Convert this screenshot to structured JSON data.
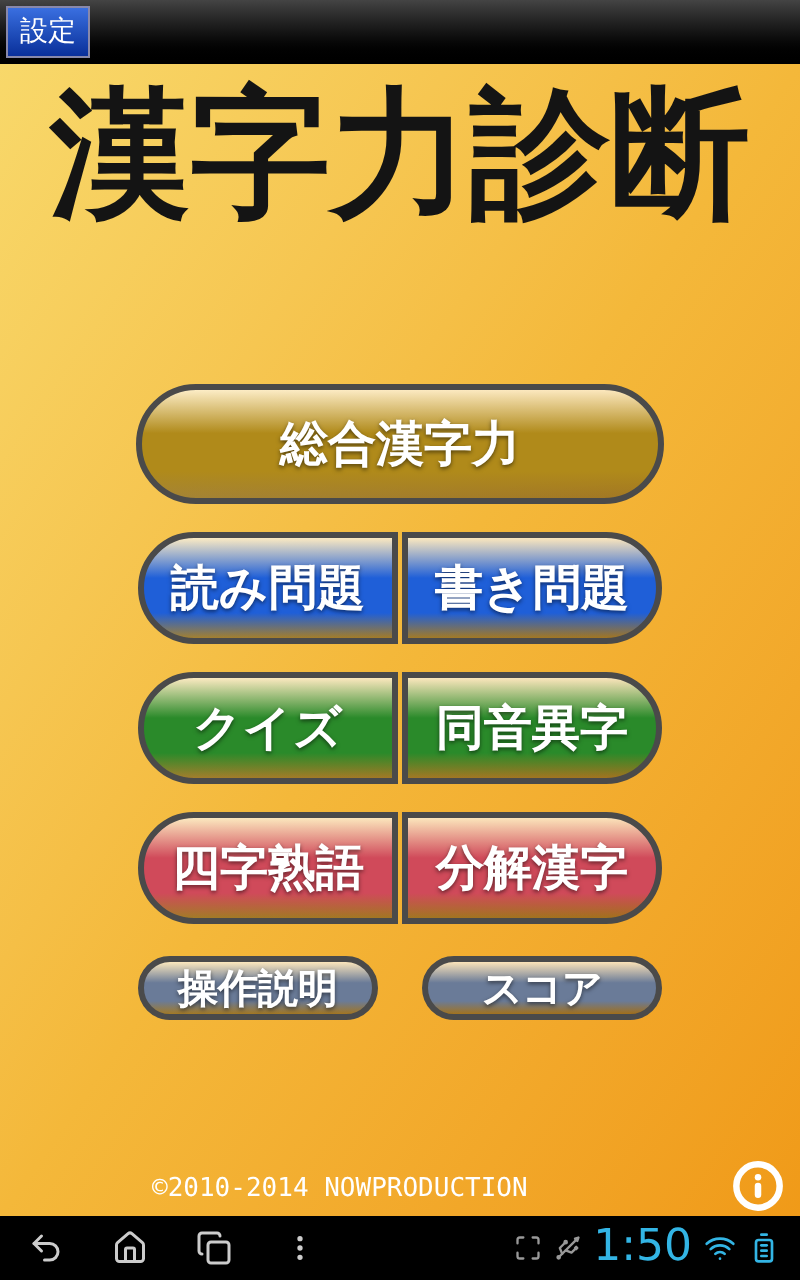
{
  "settings_button": {
    "label": "設定"
  },
  "title": "漢字力診断",
  "menu": [
    {
      "kind": "single",
      "color": "#b08a1a",
      "buttons": [
        "総合漢字力"
      ]
    },
    {
      "kind": "pair",
      "color": "#1f5fd8",
      "buttons": [
        "読み問題",
        "書き問題"
      ]
    },
    {
      "kind": "pair",
      "color": "#2a8a2a",
      "buttons": [
        "クイズ",
        "同音異字"
      ]
    },
    {
      "kind": "pair",
      "color": "#d04a5a",
      "buttons": [
        "四字熟語",
        "分解漢字"
      ]
    },
    {
      "kind": "small",
      "color": "#6a7b98",
      "buttons": [
        "操作説明",
        "スコア"
      ]
    }
  ],
  "copyright": "©2010-2014 NOWPRODUCTION",
  "status_bar": {
    "time": "1:50"
  }
}
